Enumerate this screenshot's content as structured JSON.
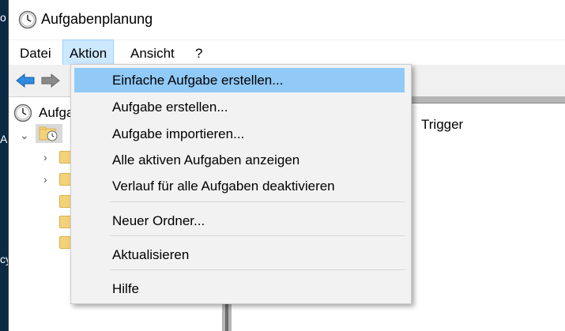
{
  "window": {
    "title": "Aufgabenplanung"
  },
  "menubar": {
    "items": [
      {
        "label": "Datei"
      },
      {
        "label": "Aktion"
      },
      {
        "label": "Ansicht"
      },
      {
        "label": "?"
      }
    ]
  },
  "tree": {
    "root_label": "Aufgabenplanung (Lokal)"
  },
  "list": {
    "column_header": "Trigger"
  },
  "action_menu": {
    "items": [
      {
        "label": "Einfache Aufgabe erstellen..."
      },
      {
        "label": "Aufgabe erstellen..."
      },
      {
        "label": "Aufgabe importieren..."
      },
      {
        "label": "Alle aktiven Aufgaben anzeigen"
      },
      {
        "label": "Verlauf für alle Aufgaben deaktivieren"
      },
      {
        "label": "Neuer Ordner..."
      },
      {
        "label": "Aktualisieren"
      },
      {
        "label": "Hilfe"
      }
    ]
  },
  "desktop": {
    "fragments": [
      "o",
      "A",
      "cy"
    ]
  },
  "colors": {
    "highlight": "#91c9f7",
    "menu_active": "#cce8ff",
    "nav_arrow": "#2f8be0"
  }
}
